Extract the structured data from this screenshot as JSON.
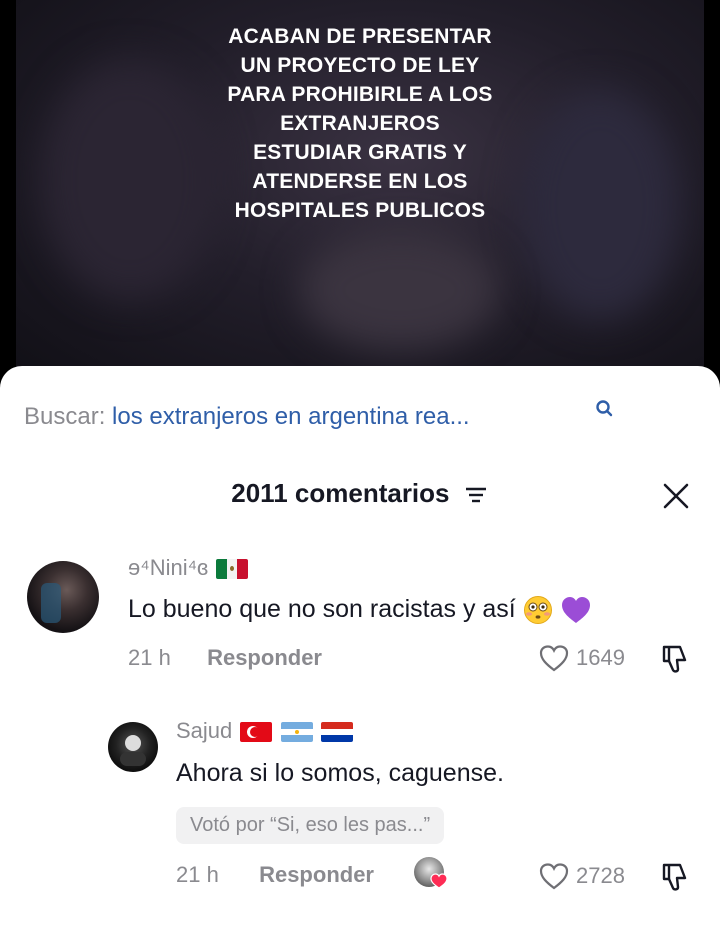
{
  "video": {
    "caption_lines": [
      "ACABAN DE PRESENTAR",
      "UN PROYECTO DE LEY",
      "PARA PROHIBIRLE A LOS",
      "EXTRANJEROS",
      "ESTUDIAR GRATIS Y",
      "ATENDERSE EN LOS",
      "HOSPITALES PUBLICOS"
    ]
  },
  "search": {
    "label": "Buscar:",
    "query": "los extranjeros en argentina rea..."
  },
  "header": {
    "title": "2011 comentarios"
  },
  "comments": [
    {
      "username": "ɘ⁴Nini⁴ɞ",
      "text": "Lo bueno que no son racistas y así",
      "time": "21 h",
      "reply_label": "Responder",
      "likes": "1649"
    }
  ],
  "replies": [
    {
      "username": "Sajud",
      "text": "Ahora si lo somos, caguense.",
      "vote": "Votó por “Si, eso les pas...”",
      "time": "21 h",
      "reply_label": "Responder",
      "likes": "2728"
    }
  ],
  "colors": {
    "link": "#2f5ea8",
    "muted": "#8a8a8f",
    "text": "#161823"
  }
}
